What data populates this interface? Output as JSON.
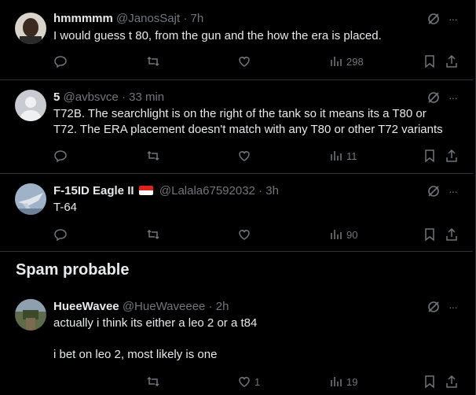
{
  "tweets": [
    {
      "name": "hmmmmm",
      "handle": "@JanosSajt",
      "dot": "·",
      "time": "7h",
      "text": "I would guess t 80, from the gun and the how the era is placed.",
      "views": "298",
      "likes": ""
    },
    {
      "name": "5",
      "handle": "@avbsvce",
      "dot": "·",
      "time": "33 min",
      "text": "T72B. The searchlight is on the right of the tank so it means its a T80 or\nT72. The ERA placement doesn't match with any T80 or other T72 variants",
      "views": "11",
      "likes": ""
    },
    {
      "name": "F-15ID Eagle II",
      "handle": "@Lalala67592032",
      "dot": "·",
      "time": "3h",
      "text": "T-64",
      "views": "90",
      "likes": ""
    },
    {
      "name": "HueeWavee",
      "handle": "@HueWaveeee",
      "dot": "·",
      "time": "2h",
      "text": "actually i think its either a leo 2 or a t84\n\ni bet on leo 2, most likely is one",
      "views": "19",
      "likes": "1"
    }
  ],
  "section": {
    "title": "Spam probable"
  },
  "more_label": "···",
  "colors": {
    "muted": "#71767b",
    "text": "#e7e9ea",
    "border": "#2f3336",
    "bg": "#000000"
  }
}
